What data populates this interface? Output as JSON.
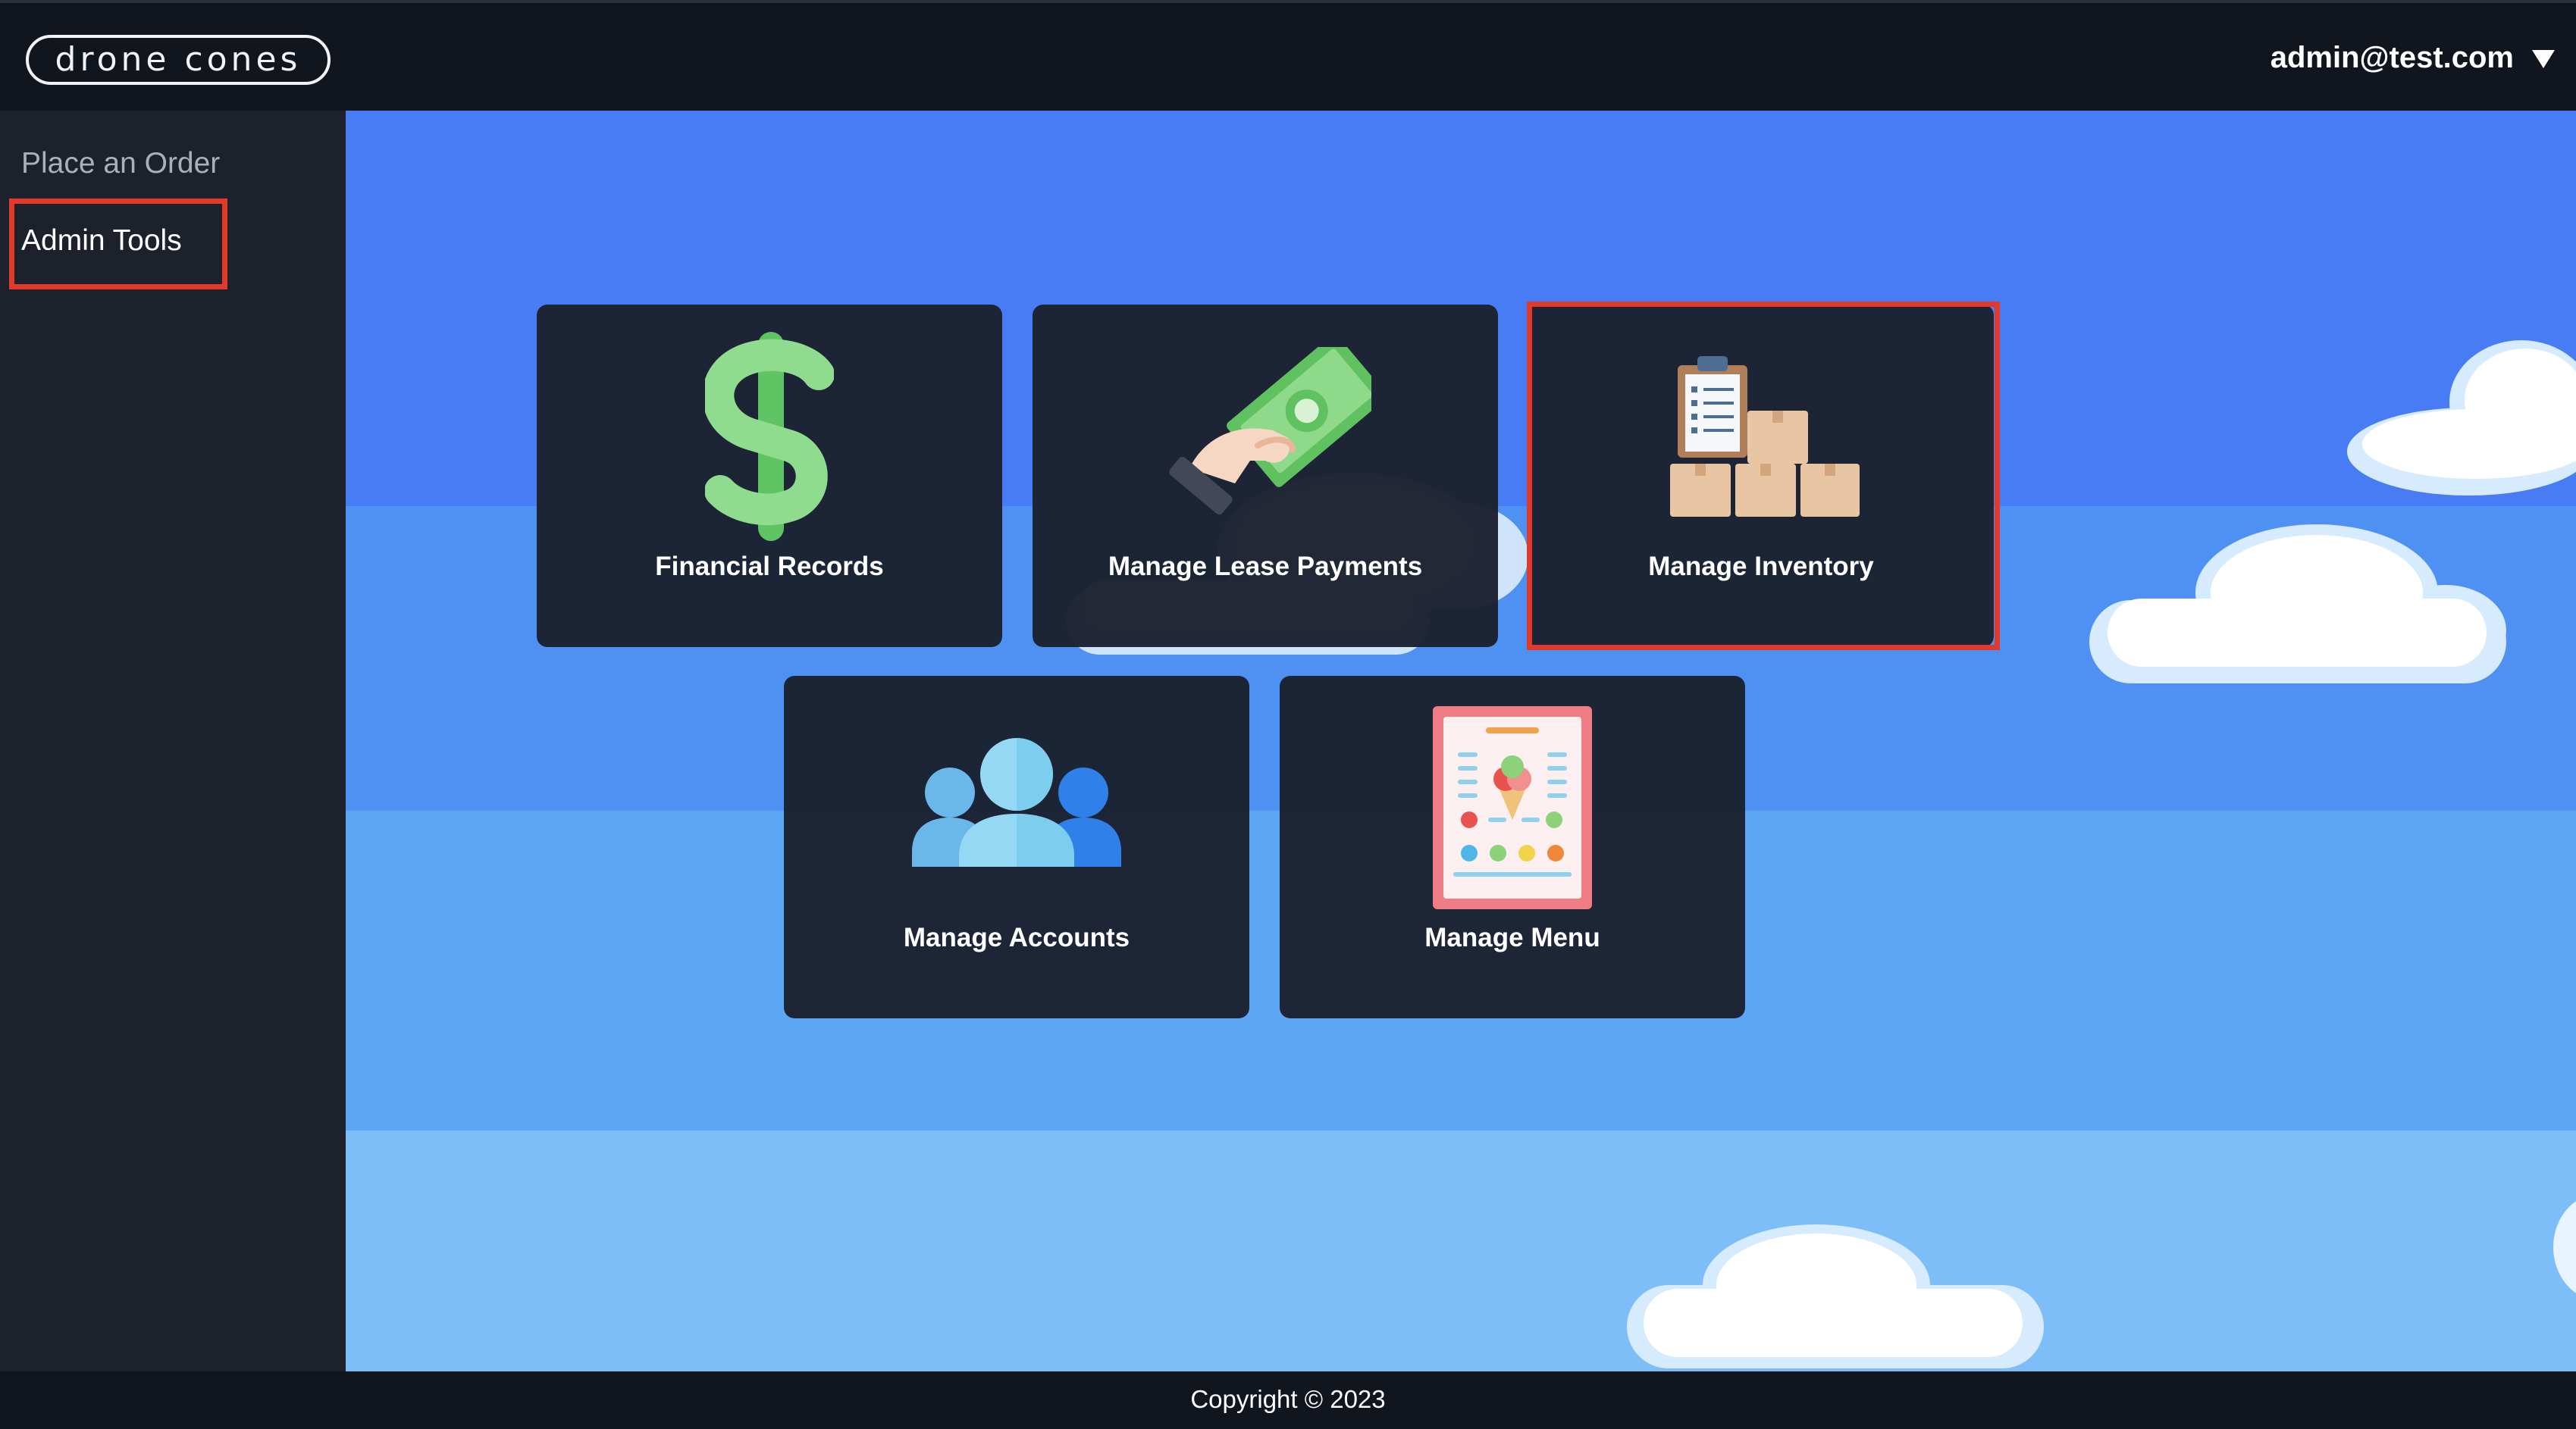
{
  "header": {
    "logo_text": "drone cones",
    "account_email": "admin@test.com",
    "account_menu_icon": "caret-down-icon"
  },
  "sidebar": {
    "items": [
      {
        "label": "Place an Order"
      },
      {
        "label": "Admin Tools"
      }
    ],
    "selected": "Admin Tools"
  },
  "cards": [
    {
      "label": "Financial Records",
      "icon": "dollar-sign-icon"
    },
    {
      "label": "Manage Lease Payments",
      "icon": "hand-money-icon"
    },
    {
      "label": "Manage Inventory",
      "icon": "clipboard-boxes-icon"
    },
    {
      "label": "Manage Accounts",
      "icon": "users-group-icon"
    },
    {
      "label": "Manage Menu",
      "icon": "ice-cream-menu-icon"
    }
  ],
  "footer": {
    "copyright": "Copyright © 2023"
  },
  "colors": {
    "highlight": "#e13a2b",
    "header_bg": "#11151e",
    "sidebar_bg": "#1c212b",
    "card_bg": "#1b212f",
    "sky_top": "#487cf4",
    "sky_bottom": "#7dbdf8"
  }
}
